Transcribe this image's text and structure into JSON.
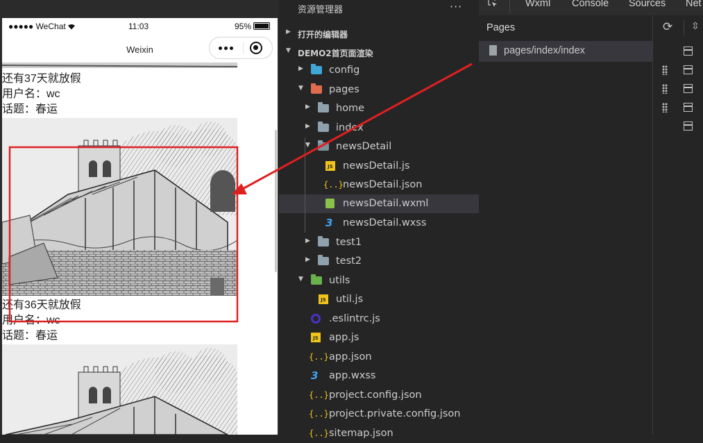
{
  "simulator": {
    "status_bar": {
      "signal": "●●●●● WeChat",
      "time": "11:03",
      "battery": "95%"
    },
    "nav_title": "Weixin",
    "posts": [
      {
        "days": "还有37天就放假",
        "user": "用户名：wc",
        "topic": "话题：春运"
      },
      {
        "days": "还有36天就放假",
        "user": "用户名：wc",
        "topic": "话题：春运"
      }
    ]
  },
  "explorer": {
    "title": "资源管理器",
    "more": "···",
    "sections": {
      "open_editors": "打开的编辑器",
      "project": "DEMO2首页面渲染"
    },
    "tree": [
      {
        "name": "config",
        "icon": "config-folder-icon"
      },
      {
        "name": "pages",
        "icon": "pages-folder-icon"
      },
      {
        "name": "home",
        "icon": "folder-icon"
      },
      {
        "name": "index",
        "icon": "folder-icon"
      },
      {
        "name": "newsDetail",
        "icon": "folder-open-icon"
      },
      {
        "name": "newsDetail.js",
        "icon": "js-file-icon"
      },
      {
        "name": "newsDetail.json",
        "icon": "json-file-icon"
      },
      {
        "name": "newsDetail.wxml",
        "icon": "wxml-file-icon"
      },
      {
        "name": "newsDetail.wxss",
        "icon": "css-file-icon"
      },
      {
        "name": "test1",
        "icon": "folder-icon"
      },
      {
        "name": "test2",
        "icon": "folder-icon"
      },
      {
        "name": "utils",
        "icon": "utils-folder-icon"
      },
      {
        "name": "util.js",
        "icon": "js-file-icon"
      },
      {
        "name": ".eslintrc.js",
        "icon": "eslint-file-icon"
      },
      {
        "name": "app.js",
        "icon": "js-file-icon"
      },
      {
        "name": "app.json",
        "icon": "json-file-icon"
      },
      {
        "name": "app.wxss",
        "icon": "css-file-icon"
      },
      {
        "name": "project.config.json",
        "icon": "json-file-icon"
      },
      {
        "name": "project.private.config.json",
        "icon": "json-file-icon"
      },
      {
        "name": "sitemap.json",
        "icon": "json-file-icon"
      }
    ],
    "icon_glyphs": {
      "js": "JS",
      "json": "{..}",
      "css": "3"
    }
  },
  "devtools": {
    "tabs": [
      "Wxml",
      "Console",
      "Sources",
      "Net"
    ],
    "pages_title": "Pages",
    "pages": [
      "pages/index/index"
    ]
  },
  "colors": {
    "annotation": "#e02020",
    "selected_row": "#37373d",
    "editor_bg": "#252526"
  }
}
